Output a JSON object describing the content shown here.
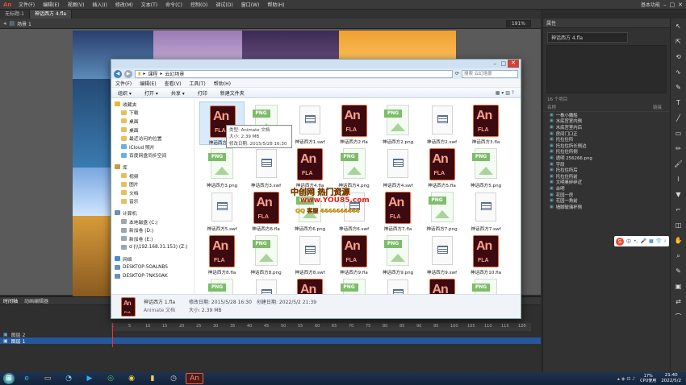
{
  "animate": {
    "menus": [
      "文件(F)",
      "编辑(E)",
      "视图(V)",
      "插入(I)",
      "修改(M)",
      "文本(T)",
      "命令(C)",
      "控制(O)",
      "调试(D)",
      "窗口(W)",
      "帮助(H)"
    ],
    "workspace": "基本功能",
    "tabs": [
      "无标题-1",
      "神话西方 4.fla"
    ],
    "scene": "场景 1",
    "zoom": "191%",
    "doc_name": "神话西方 4.fla",
    "properties_tab": "属性",
    "library_header": "16 个项目",
    "library_items": [
      "一株小嫩船",
      "水底宫室内侧",
      "水底宫室内后",
      "房间门口正",
      "托拉住所",
      "托拉住所长侧边",
      "托拉住所侧",
      "透明 256266.png",
      "宇段",
      "托拉住所后",
      "托拉住所前",
      "文明奥碎碎近",
      "台明",
      "花园一房",
      "花园一角前",
      "墙脚玻璃杯侧"
    ]
  },
  "timeline": {
    "tab_timeline": "时间轴",
    "tab_motion": "动画编辑器",
    "layers": [
      "图层 2",
      "图层 1"
    ],
    "frames": [
      "1",
      "5",
      "10",
      "15",
      "20",
      "25",
      "30",
      "35",
      "40",
      "45",
      "50",
      "55",
      "60",
      "65",
      "70",
      "75",
      "80",
      "85",
      "90",
      "95",
      "100",
      "105",
      "110",
      "115",
      "120"
    ]
  },
  "explorer": {
    "breadcrumb": [
      "课程",
      "云幻场景"
    ],
    "search_placeholder": "搜索 云幻场景",
    "menu": [
      "文件(F)",
      "编辑(E)",
      "查看(V)",
      "工具(T)",
      "帮助(H)"
    ],
    "commands": [
      "组织 ▾",
      "打开 ▾",
      "共享 ▾",
      "打印",
      "新建文件夹"
    ],
    "nav": [
      {
        "label": "收藏夹",
        "type": "star"
      },
      {
        "label": "下载",
        "type": "folder"
      },
      {
        "label": "桌面",
        "type": "folder"
      },
      {
        "label": "桌面",
        "type": "folder"
      },
      {
        "label": "最近访问的位置",
        "type": "folder"
      },
      {
        "label": "iCloud 照片",
        "type": "cloud"
      },
      {
        "label": "百度网盘同步空间",
        "type": "cloud"
      },
      {
        "label": "",
        "type": "gap"
      },
      {
        "label": "库",
        "type": "lib"
      },
      {
        "label": "视频",
        "type": "folder"
      },
      {
        "label": "图片",
        "type": "folder"
      },
      {
        "label": "文档",
        "type": "folder"
      },
      {
        "label": "音乐",
        "type": "folder"
      },
      {
        "label": "",
        "type": "gap"
      },
      {
        "label": "计算机",
        "type": "pc"
      },
      {
        "label": "本地磁盘 (C:)",
        "type": "disk"
      },
      {
        "label": "新加卷 (D:)",
        "type": "disk"
      },
      {
        "label": "新加卷 (E:)",
        "type": "disk"
      },
      {
        "label": "d (\\\\192.168.31.153) (Z:)",
        "type": "disk"
      },
      {
        "label": "",
        "type": "gap"
      },
      {
        "label": "网络",
        "type": "net"
      },
      {
        "label": "DESKTOP-5OALNBS",
        "type": "pc"
      },
      {
        "label": "DESKTOP-7NKS0AK",
        "type": "pc"
      }
    ],
    "files": [
      {
        "name": "神话西方1.fla",
        "type": "fla"
      },
      {
        "name": "",
        "type": "png"
      },
      {
        "name": "神话西方1.swf",
        "type": "swf"
      },
      {
        "name": "神话西方2.fla",
        "type": "fla"
      },
      {
        "name": "神话西方2.png",
        "type": "png"
      },
      {
        "name": "神话西方2.swf",
        "type": "swf"
      },
      {
        "name": "神话西方3.fla",
        "type": "fla"
      },
      {
        "name": "神话西方3.png",
        "type": "png"
      },
      {
        "name": "神话西方3.swf",
        "type": "swf"
      },
      {
        "name": "神话西方4.fla",
        "type": "fla"
      },
      {
        "name": "神话西方4.png",
        "type": "png"
      },
      {
        "name": "神话西方4.swf",
        "type": "swf"
      },
      {
        "name": "神话西方5.fla",
        "type": "fla"
      },
      {
        "name": "神话西方5.png",
        "type": "png"
      },
      {
        "name": "神话西方5.swf",
        "type": "swf"
      },
      {
        "name": "神话西方6.fla",
        "type": "fla"
      },
      {
        "name": "神话西方6.png",
        "type": "png"
      },
      {
        "name": "神话西方6.swf",
        "type": "swf"
      },
      {
        "name": "神话西方7.fla",
        "type": "fla"
      },
      {
        "name": "神话西方7.png",
        "type": "png"
      },
      {
        "name": "神话西方7.swf",
        "type": "swf"
      },
      {
        "name": "神话西方8.fla",
        "type": "fla"
      },
      {
        "name": "神话西方8.png",
        "type": "png"
      },
      {
        "name": "神话西方8.swf",
        "type": "swf"
      },
      {
        "name": "神话西方9.fla",
        "type": "fla"
      },
      {
        "name": "神话西方9.png",
        "type": "png"
      },
      {
        "name": "神话西方9.swf",
        "type": "swf"
      },
      {
        "name": "神话西方10.fla",
        "type": "fla"
      },
      {
        "name": "",
        "type": "png"
      },
      {
        "name": "",
        "type": "swf"
      },
      {
        "name": "",
        "type": "fla"
      },
      {
        "name": "",
        "type": "png"
      },
      {
        "name": "",
        "type": "swf"
      },
      {
        "name": "",
        "type": "fla"
      },
      {
        "name": "",
        "type": "png"
      }
    ],
    "tooltip": {
      "type": "类型: Animate 文档",
      "size": "大小: 2.39 MB",
      "modified": "修改日期: 2015/5/28 16:30"
    },
    "status": {
      "name": "神话西方 1.fla",
      "kind": "Animate 文档",
      "modified": "修改日期: 2015/5/28 16:30",
      "created": "创建日期: 2022/5/2 21:39",
      "size": "大小: 2.39 MB"
    }
  },
  "watermark": {
    "line1": "中创网 热门资源",
    "line2": "www.YOU85.com",
    "line3": "QQ 客服 4444444444"
  },
  "taskbar": {
    "cpu": "17%",
    "cpu_label": "CPU使用",
    "time": "21:40",
    "date": "2022/5/2"
  },
  "colors": {
    "fla_border": "#e56a3f",
    "png_tag": "#7dbc6a",
    "accent": "#3b84c8"
  }
}
